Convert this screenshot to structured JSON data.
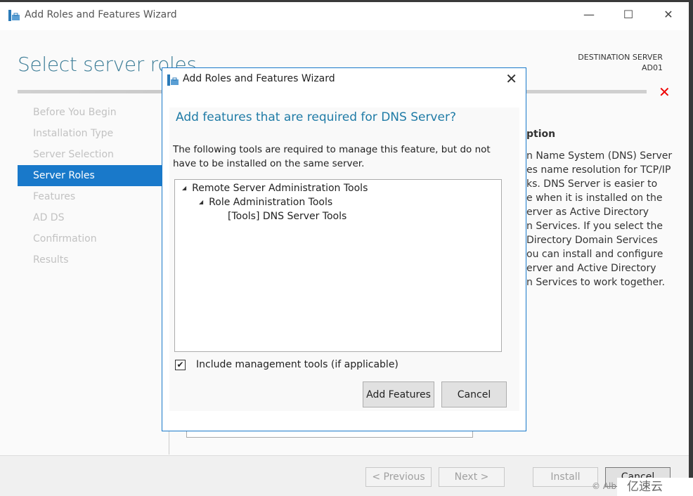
{
  "window": {
    "title": "Add Roles and Features Wizard",
    "controls": {
      "minimize": "—",
      "maximize": "☐",
      "close": "✕"
    }
  },
  "page": {
    "title": "Select server roles",
    "destination_label": "DESTINATION SERVER",
    "destination_server": "AD01",
    "error_icon": "✕"
  },
  "nav": {
    "items": [
      {
        "label": "Before You Begin"
      },
      {
        "label": "Installation Type"
      },
      {
        "label": "Server Selection"
      },
      {
        "label": "Server Roles",
        "active": true
      },
      {
        "label": "Features"
      },
      {
        "label": "AD DS"
      },
      {
        "label": "Confirmation"
      },
      {
        "label": "Results"
      }
    ]
  },
  "description": {
    "heading": "ption",
    "lines": [
      "n Name System (DNS) Server",
      "es name resolution for TCP/IP",
      "ks. DNS Server is easier to",
      "e when it is installed on the",
      "erver as Active Directory",
      "n Services. If you select the",
      "Directory Domain Services",
      "ou can install and configure",
      "erver and Active Directory",
      "n Services to work together."
    ]
  },
  "footer": {
    "previous": "< Previous",
    "next": "Next >",
    "install": "Install",
    "cancel": "Cancel"
  },
  "watermark": {
    "left": "© Alb",
    "right": "亿速云"
  },
  "dialog": {
    "title": "Add Roles and Features Wizard",
    "close": "✕",
    "heading": "Add features that are required for DNS Server?",
    "message": "The following tools are required to manage this feature, but do not have to be installed on the same server.",
    "tree": [
      {
        "label": "Remote Server Administration Tools",
        "expanded": true
      },
      {
        "label": "Role Administration Tools",
        "expanded": true
      },
      {
        "label": "[Tools] DNS Server Tools"
      }
    ],
    "include_tools": {
      "label": "Include management tools (if applicable)",
      "checked": true
    },
    "add_button": "Add Features",
    "cancel_button": "Cancel"
  },
  "colors": {
    "accent": "#1979ca",
    "heading": "#3d7d97",
    "error": "#e00000"
  }
}
